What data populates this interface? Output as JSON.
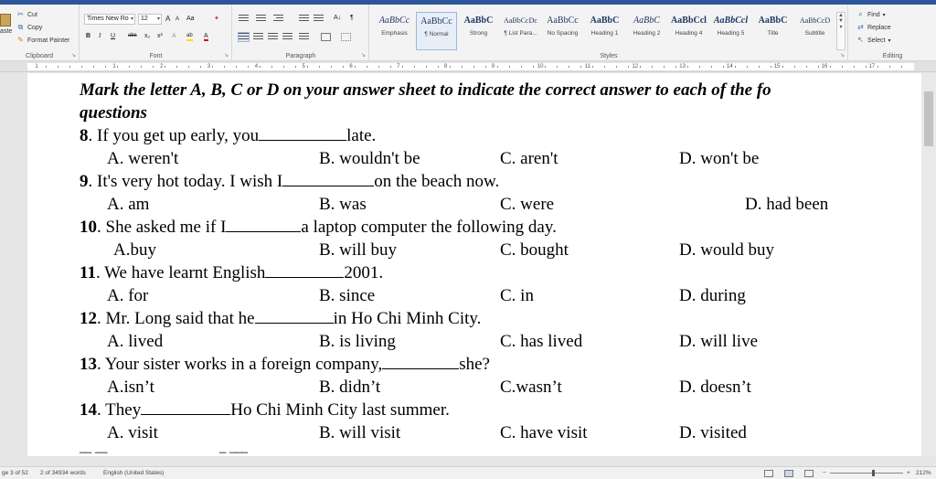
{
  "ribbon": {
    "clipboard": {
      "paste_label": "aste",
      "cut_label": "Cut",
      "copy_label": "Copy",
      "format_painter_label": "Format Painter",
      "group_label": "Clipboard"
    },
    "font": {
      "font_name": "Times New Ro",
      "font_size": "12",
      "grow_label": "A",
      "shrink_label": "A",
      "case_label": "Aa",
      "bold": "B",
      "italic": "I",
      "underline": "U",
      "strike": "abc",
      "subscript": "x₂",
      "superscript": "x²",
      "highlight_label": "ab",
      "font_color_label": "A",
      "group_label": "Font"
    },
    "paragraph": {
      "sort_label": "A↓",
      "pilcrow_label": "¶",
      "group_label": "Paragraph"
    },
    "styles": {
      "items": [
        {
          "preview": "AaBbCc",
          "name": "Emphasis"
        },
        {
          "preview": "AaBbCc",
          "name": "¶ Normal"
        },
        {
          "preview": "AaBbC",
          "name": "Strong"
        },
        {
          "preview": "AaBbCcDc",
          "name": "¶ List Para..."
        },
        {
          "preview": "AaBbCc",
          "name": "No Spacing"
        },
        {
          "preview": "AaBbC",
          "name": "Heading 1"
        },
        {
          "preview": "AaBbC",
          "name": "Heading 2"
        },
        {
          "preview": "AaBbCcl",
          "name": "Heading 4"
        },
        {
          "preview": "AaBbCcl",
          "name": "Heading 5"
        },
        {
          "preview": "AaBbC",
          "name": "Title"
        },
        {
          "preview": "AaBbCcD",
          "name": "Subtitle"
        }
      ],
      "group_label": "Styles"
    },
    "editing": {
      "find_label": "Find",
      "replace_label": "Replace",
      "select_label": "Select",
      "group_label": "Editing"
    }
  },
  "ruler": {
    "numbers": [
      "1",
      "1",
      "2",
      "3",
      "4",
      "5",
      "6",
      "7",
      "8",
      "9",
      "10",
      "11",
      "12",
      "13",
      "14",
      "15",
      "16",
      "17"
    ]
  },
  "document": {
    "instruction_line1": "Mark the letter A, B, C or D on your answer sheet to indicate the correct answer to each of the fo",
    "instruction_line2": "questions",
    "questions": [
      {
        "num": "8",
        "pre": "If you get up early, you",
        "post": "late.",
        "a": "A. weren't",
        "b": "B. wouldn't be",
        "c": "C. aren't",
        "d": "D. won't be"
      },
      {
        "num": "9",
        "pre": "It's very hot today. I wish I",
        "post": "on the beach now.",
        "a": "A. am",
        "b": "B. was",
        "c": "C. were",
        "d": "D. had been"
      },
      {
        "num": "10",
        "pre": "She asked me if I",
        "post": "a laptop computer the following day.",
        "a": "A.buy",
        "b": "B. will buy",
        "c": "C. bought",
        "d": "D. would buy"
      },
      {
        "num": "11",
        "pre": "We have learnt English",
        "post": "2001.",
        "a": "A. for",
        "b": "B. since",
        "c": "C. in",
        "d": "D. during"
      },
      {
        "num": "12",
        "pre": "Mr. Long said that he",
        "post": "in Ho Chi Minh City.",
        "a": "A. lived",
        "b": "B. is living",
        "c": "C. has lived",
        "d": "D. will live"
      },
      {
        "num": "13",
        "pre": "Your sister works in a foreign company,",
        "post": "she?",
        "a": "A.isn’t",
        "b": "B. didn’t",
        "c": "C.wasn’t",
        "d": "D. doesn’t"
      },
      {
        "num": "14",
        "pre": "They",
        "post": "Ho Chi Minh City last summer.",
        "a": "A. visit",
        "b": "B. will visit",
        "c": "C. have visit",
        "d": "D. visited"
      }
    ]
  },
  "status": {
    "page": "ge 3 of 52",
    "words": "2 of 34934 words",
    "language": "English (United States)",
    "zoom": "212%",
    "zoom_minus": "−",
    "zoom_plus": "+"
  }
}
